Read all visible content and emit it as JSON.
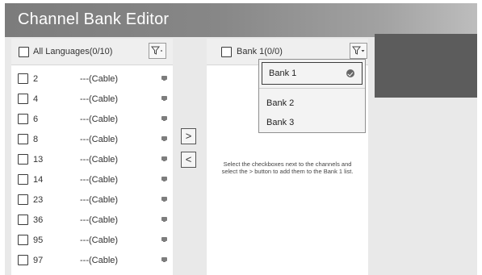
{
  "window": {
    "title": "Channel Bank Editor"
  },
  "left_panel": {
    "select_all_label": "All Languages(0/10)",
    "filter_icon": "filter-icon",
    "channels": [
      {
        "number": "2",
        "name": "---(Cable)"
      },
      {
        "number": "4",
        "name": "---(Cable)"
      },
      {
        "number": "6",
        "name": "---(Cable)"
      },
      {
        "number": "8",
        "name": "---(Cable)"
      },
      {
        "number": "13",
        "name": "---(Cable)"
      },
      {
        "number": "14",
        "name": "---(Cable)"
      },
      {
        "number": "23",
        "name": "---(Cable)"
      },
      {
        "number": "36",
        "name": "---(Cable)"
      },
      {
        "number": "95",
        "name": "---(Cable)"
      },
      {
        "number": "97",
        "name": "---(Cable)"
      }
    ]
  },
  "middle": {
    "add_label": ">",
    "remove_label": "<"
  },
  "right_panel": {
    "select_all_label": "Bank 1(0/0)",
    "hint": "Select the checkboxes next to the channels and select the > button to add them to the Bank 1 list."
  },
  "dropdown": {
    "items": [
      "Bank 1",
      "Bank 2",
      "Bank 3"
    ],
    "selected": "Bank 1"
  },
  "colors": {
    "title_bar": "#7c7c7c",
    "background": "#e9e9e9",
    "dark_block": "#5c5c5c"
  }
}
